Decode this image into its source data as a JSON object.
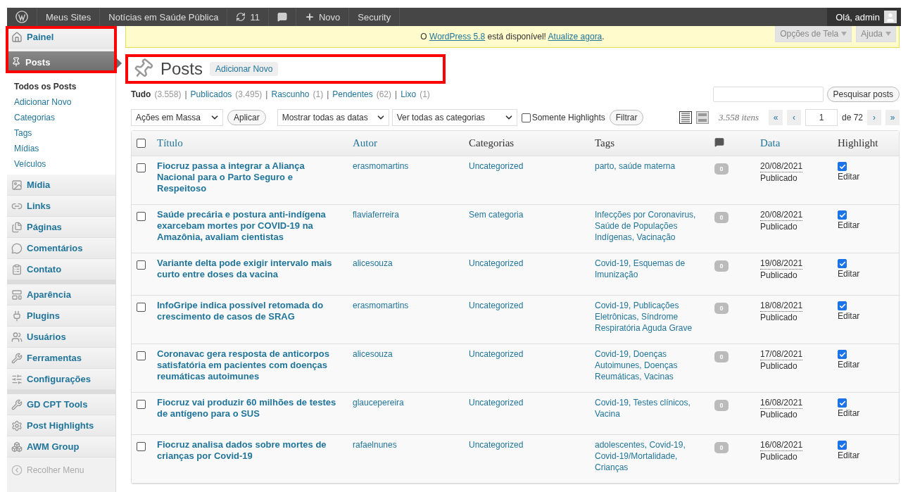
{
  "admin_bar": {
    "items": [
      {
        "kind": "logo"
      },
      {
        "kind": "text",
        "label": "Meus Sites"
      },
      {
        "kind": "text",
        "label": "Notícias em Saúde Pública"
      },
      {
        "kind": "updates",
        "label": "11"
      },
      {
        "kind": "comments"
      },
      {
        "kind": "new",
        "label": "Novo"
      },
      {
        "kind": "text",
        "label": "Security"
      }
    ],
    "greeting": "Olá, admin"
  },
  "sidebar": {
    "highlighted_group": true,
    "top": [
      {
        "label": "Painel",
        "selected": false
      },
      {
        "label": "Posts",
        "selected": true
      }
    ],
    "submenu": [
      {
        "label": "Todos os Posts",
        "selected": true
      },
      {
        "label": "Adicionar Novo",
        "selected": false
      },
      {
        "label": "Categorias",
        "selected": false
      },
      {
        "label": "Tags",
        "selected": false
      },
      {
        "label": "Mídias",
        "selected": false
      },
      {
        "label": "Veículos",
        "selected": false
      }
    ],
    "groups": [
      [
        {
          "label": "Mídia"
        },
        {
          "label": "Links"
        },
        {
          "label": "Páginas"
        },
        {
          "label": "Comentários"
        },
        {
          "label": "Contato"
        }
      ],
      [
        {
          "label": "Aparência"
        },
        {
          "label": "Plugins"
        },
        {
          "label": "Usuários"
        },
        {
          "label": "Ferramentas"
        },
        {
          "label": "Configurações"
        }
      ],
      [
        {
          "label": "GD CPT Tools"
        },
        {
          "label": "Post Highlights"
        },
        {
          "label": "AWM Group"
        }
      ]
    ],
    "collapse": "Recolher Menu"
  },
  "notice": {
    "before": "O ",
    "link": "WordPress 5.8",
    "middle": " está disponível! ",
    "action": "Atualize agora",
    "after": "."
  },
  "screen_tabs": [
    "Opções de Tela",
    "Ajuda"
  ],
  "header": {
    "title": "Posts",
    "add_new": "Adicionar Novo",
    "highlighted": true
  },
  "filter_separator": "|",
  "status_filters": [
    {
      "label": "Tudo",
      "count": "(3.558)",
      "selected": true
    },
    {
      "label": "Publicados",
      "count": "(3.495)",
      "selected": false
    },
    {
      "label": "Rascunho",
      "count": "(1)",
      "selected": false
    },
    {
      "label": "Pendentes",
      "count": "(62)",
      "selected": false
    },
    {
      "label": "Lixo",
      "count": "(1)",
      "selected": false
    }
  ],
  "search": {
    "button": "Pesquisar posts"
  },
  "toolbar": {
    "bulk": "Ações em Massa",
    "apply": "Aplicar",
    "dates": "Mostrar todas as datas",
    "categories": "Ver todas as categorias",
    "highlight_only": {
      "label": "Somente Highlights",
      "checked": false
    },
    "filter": "Filtrar",
    "view_mode": [
      {
        "selected": true
      },
      {
        "selected": false
      }
    ],
    "count": "3.558 itens",
    "pagination": {
      "first": "«",
      "prev": "‹",
      "page": "1",
      "total": "de 72",
      "next": "›",
      "last": "»"
    }
  },
  "table": {
    "select_all": false,
    "columns": [
      "Título",
      "Autor",
      "Categorias",
      "Tags",
      "Data",
      "Highlight"
    ],
    "rows": [
      {
        "title": "Fiocruz passa a integrar a Aliança Nacional para o Parto Seguro e Respeitoso",
        "author": "erasmomartins",
        "category": "Uncategorized",
        "tags": "parto, saúde materna",
        "comments": "0",
        "date": "20/08/2021",
        "status": "Publicado",
        "highlight": true,
        "edit": "Editar",
        "selected": false
      },
      {
        "title": "Saúde precária e postura anti-indígena exarcebam mortes por COVID-19 na Amazônia, avaliam cientistas",
        "author": "flaviaferreira",
        "category": "Sem categoria",
        "tags": "Infecções por Coronavirus, Saúde de Populações Indígenas, Vacinação",
        "comments": "0",
        "date": "20/08/2021",
        "status": "Publicado",
        "highlight": true,
        "edit": "Editar",
        "selected": false
      },
      {
        "title": "Variante delta pode exigir intervalo mais curto entre doses da vacina",
        "author": "alicesouza",
        "category": "Uncategorized",
        "tags": "Covid-19, Esquemas de Imunização",
        "comments": "0",
        "date": "19/08/2021",
        "status": "Publicado",
        "highlight": true,
        "edit": "Editar",
        "selected": false
      },
      {
        "title": "InfoGripe indica possível retomada do crescimento de casos de SRAG",
        "author": "erasmomartins",
        "category": "Uncategorized",
        "tags": "Covid-19, Publicações Eletrônicas, Síndrome Respiratória Aguda Grave",
        "comments": "0",
        "date": "18/08/2021",
        "status": "Publicado",
        "highlight": true,
        "edit": "Editar",
        "selected": false
      },
      {
        "title": "Coronavac gera resposta de anticorpos satisfatória em pacientes com doenças reumáticas autoimunes",
        "author": "alicesouza",
        "category": "Uncategorized",
        "tags": "Covid-19, Doenças Autoimunes, Doenças Reumáticas, Vacinas",
        "comments": "0",
        "date": "17/08/2021",
        "status": "Publicado",
        "highlight": true,
        "edit": "Editar",
        "selected": false
      },
      {
        "title": "Fiocruz vai produzir 60 milhões de testes de antígeno para o SUS",
        "author": "glaucepereira",
        "category": "Uncategorized",
        "tags": "Covid-19, Testes clínicos, Vacina",
        "comments": "0",
        "date": "16/08/2021",
        "status": "Publicado",
        "highlight": true,
        "edit": "Editar",
        "selected": false
      },
      {
        "title": "Fiocruz analisa dados sobre mortes de crianças por Covid-19",
        "author": "rafaelnunes",
        "category": "Uncategorized",
        "tags": "adolescentes, Covid-19, Covid-19/Mortalidade, Crianças",
        "comments": "0",
        "date": "16/08/2021",
        "status": "Publicado",
        "highlight": true,
        "edit": "Editar",
        "selected": false
      }
    ]
  }
}
